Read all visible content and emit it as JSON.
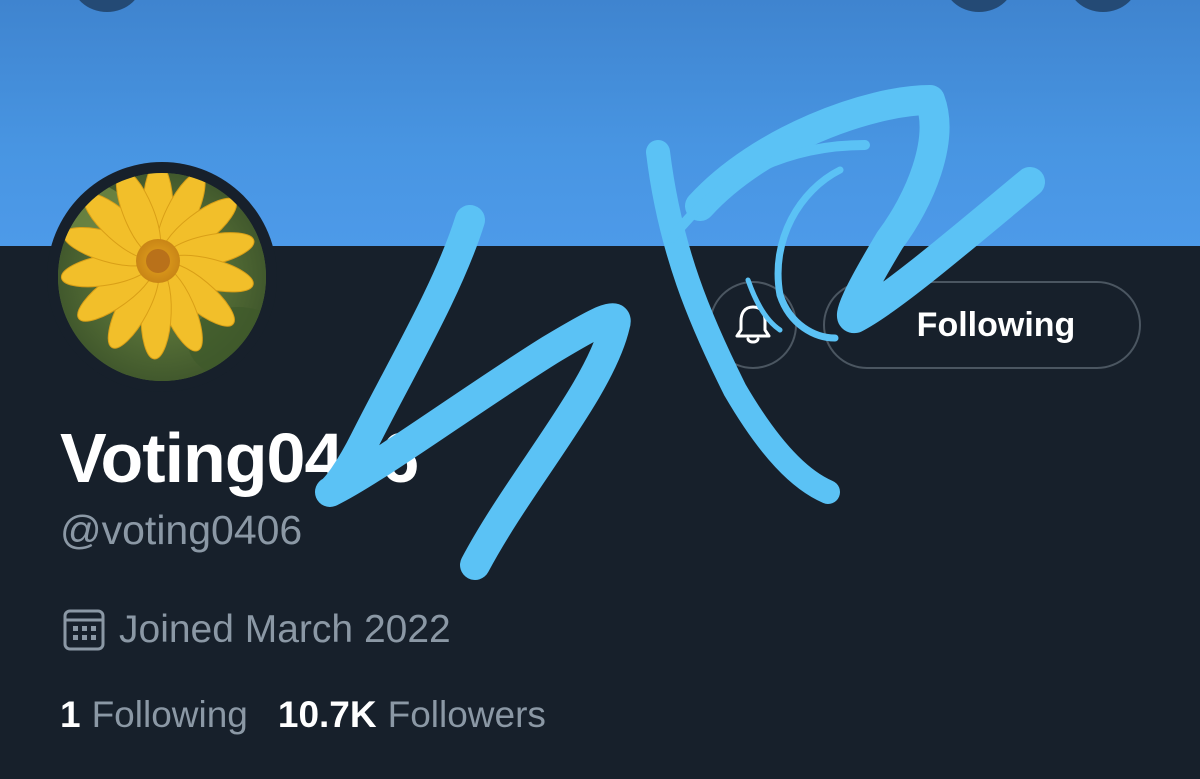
{
  "profile": {
    "display_name": "Voting0406",
    "handle": "@voting0406",
    "joined": "Joined March 2022",
    "following_count": "1",
    "following_label": "Following",
    "followers_count": "10.7K",
    "followers_label": "Followers"
  },
  "actions": {
    "notification_icon": "bell-icon",
    "follow_button_label": "Following"
  },
  "icons": {
    "joined": "calendar-icon",
    "nav_left": "back-icon",
    "nav_right_1": "search-icon",
    "nav_right_2": "more-icon"
  },
  "colors": {
    "banner": "#4895e2",
    "background": "#17202b",
    "primary_text": "#ffffff",
    "secondary_text": "#8b98a5",
    "button_border": "#4b5661",
    "scribble": "#5bc2f5"
  }
}
